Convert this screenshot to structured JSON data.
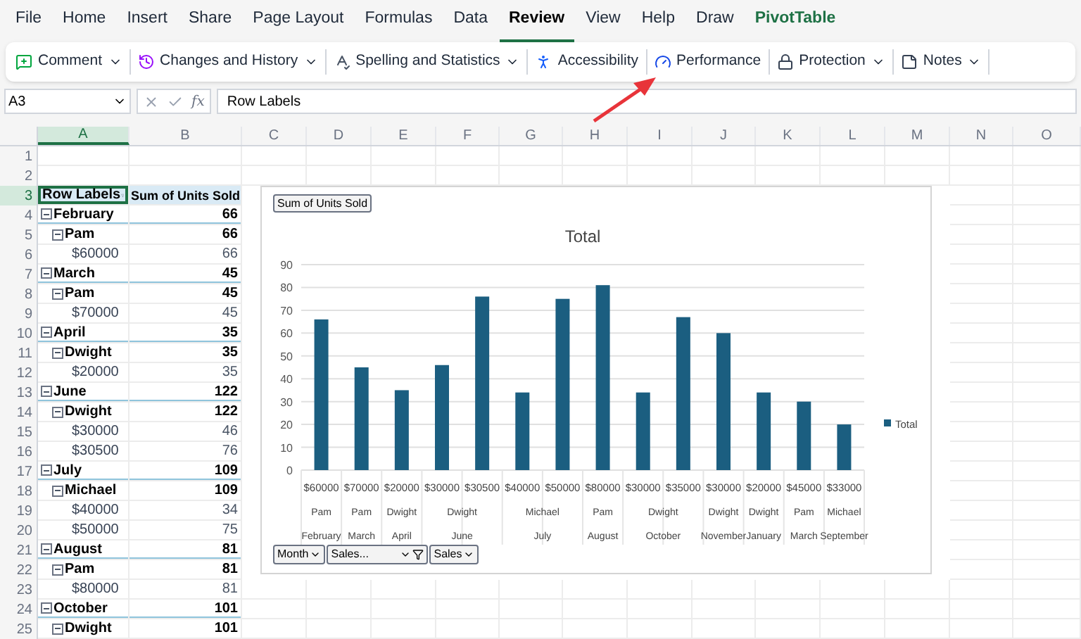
{
  "menu_tabs": [
    {
      "label": "File",
      "selected": false,
      "kind": "normal"
    },
    {
      "label": "Home",
      "selected": false,
      "kind": "normal"
    },
    {
      "label": "Insert",
      "selected": false,
      "kind": "normal"
    },
    {
      "label": "Share",
      "selected": false,
      "kind": "normal"
    },
    {
      "label": "Page Layout",
      "selected": false,
      "kind": "normal"
    },
    {
      "label": "Formulas",
      "selected": false,
      "kind": "normal"
    },
    {
      "label": "Data",
      "selected": false,
      "kind": "normal"
    },
    {
      "label": "Review",
      "selected": true,
      "kind": "normal"
    },
    {
      "label": "View",
      "selected": false,
      "kind": "normal"
    },
    {
      "label": "Help",
      "selected": false,
      "kind": "normal"
    },
    {
      "label": "Draw",
      "selected": false,
      "kind": "normal"
    },
    {
      "label": "PivotTable",
      "selected": false,
      "kind": "contextual"
    }
  ],
  "ribbon": [
    {
      "label": "Comment",
      "dropdown": true
    },
    {
      "label": "Changes and History",
      "dropdown": true
    },
    {
      "label": "Spelling and Statistics",
      "dropdown": true
    },
    {
      "label": "Accessibility",
      "dropdown": false
    },
    {
      "label": "Performance",
      "dropdown": false
    },
    {
      "label": "Protection",
      "dropdown": true
    },
    {
      "label": "Notes",
      "dropdown": true
    }
  ],
  "formula_bar": {
    "name_box": "A3",
    "fx": "fx",
    "value": "Row Labels"
  },
  "columns": [
    {
      "label": "A",
      "selected": true
    },
    {
      "label": "B",
      "selected": false
    },
    {
      "label": "C",
      "selected": false
    },
    {
      "label": "D",
      "selected": false
    },
    {
      "label": "E",
      "selected": false
    },
    {
      "label": "F",
      "selected": false
    },
    {
      "label": "G",
      "selected": false
    },
    {
      "label": "H",
      "selected": false
    },
    {
      "label": "I",
      "selected": false
    },
    {
      "label": "J",
      "selected": false
    },
    {
      "label": "K",
      "selected": false
    },
    {
      "label": "L",
      "selected": false
    },
    {
      "label": "M",
      "selected": false
    },
    {
      "label": "N",
      "selected": false
    },
    {
      "label": "O",
      "selected": false
    }
  ],
  "rows": [
    {
      "label": "1",
      "selected": false
    },
    {
      "label": "2",
      "selected": false
    },
    {
      "label": "3",
      "selected": true
    },
    {
      "label": "4",
      "selected": false
    },
    {
      "label": "5",
      "selected": false
    },
    {
      "label": "6",
      "selected": false
    },
    {
      "label": "7",
      "selected": false
    },
    {
      "label": "8",
      "selected": false
    },
    {
      "label": "9",
      "selected": false
    },
    {
      "label": "10",
      "selected": false
    },
    {
      "label": "11",
      "selected": false
    },
    {
      "label": "12",
      "selected": false
    },
    {
      "label": "13",
      "selected": false
    },
    {
      "label": "14",
      "selected": false
    },
    {
      "label": "15",
      "selected": false
    },
    {
      "label": "16",
      "selected": false
    },
    {
      "label": "17",
      "selected": false
    },
    {
      "label": "18",
      "selected": false
    },
    {
      "label": "19",
      "selected": false
    },
    {
      "label": "20",
      "selected": false
    },
    {
      "label": "21",
      "selected": false
    },
    {
      "label": "22",
      "selected": false
    },
    {
      "label": "23",
      "selected": false
    },
    {
      "label": "24",
      "selected": false
    },
    {
      "label": "25",
      "selected": false
    }
  ],
  "pivot": {
    "header": {
      "row_labels": "Row Labels",
      "values": "Sum of Units Sold"
    },
    "items": [
      {
        "kind": "group",
        "label": "February",
        "value": "66",
        "expanded": true,
        "children": [
          {
            "kind": "group",
            "label": "Pam",
            "value": "66",
            "expanded": true,
            "children": [
              {
                "kind": "leaf",
                "label": "$60000",
                "value": "66"
              }
            ]
          }
        ]
      },
      {
        "kind": "group",
        "label": "March",
        "value": "45",
        "expanded": true,
        "children": [
          {
            "kind": "group",
            "label": "Pam",
            "value": "45",
            "expanded": true,
            "children": [
              {
                "kind": "leaf",
                "label": "$70000",
                "value": "45"
              }
            ]
          }
        ]
      },
      {
        "kind": "group",
        "label": "April",
        "value": "35",
        "expanded": true,
        "children": [
          {
            "kind": "group",
            "label": "Dwight",
            "value": "35",
            "expanded": true,
            "children": [
              {
                "kind": "leaf",
                "label": "$20000",
                "value": "35"
              }
            ]
          }
        ]
      },
      {
        "kind": "group",
        "label": "June",
        "value": "122",
        "expanded": true,
        "children": [
          {
            "kind": "group",
            "label": "Dwight",
            "value": "122",
            "expanded": true,
            "children": [
              {
                "kind": "leaf",
                "label": "$30000",
                "value": "46"
              },
              {
                "kind": "leaf",
                "label": "$30500",
                "value": "76"
              }
            ]
          }
        ]
      },
      {
        "kind": "group",
        "label": "July",
        "value": "109",
        "expanded": true,
        "children": [
          {
            "kind": "group",
            "label": "Michael",
            "value": "109",
            "expanded": true,
            "children": [
              {
                "kind": "leaf",
                "label": "$40000",
                "value": "34"
              },
              {
                "kind": "leaf",
                "label": "$50000",
                "value": "75"
              }
            ]
          }
        ]
      },
      {
        "kind": "group",
        "label": "August",
        "value": "81",
        "expanded": true,
        "children": [
          {
            "kind": "group",
            "label": "Pam",
            "value": "81",
            "expanded": true,
            "children": [
              {
                "kind": "leaf",
                "label": "$80000",
                "value": "81"
              }
            ]
          }
        ]
      },
      {
        "kind": "group",
        "label": "October",
        "value": "101",
        "expanded": true,
        "children": [
          {
            "kind": "group",
            "label": "Dwight",
            "value": "101",
            "expanded": true
          }
        ]
      }
    ]
  },
  "pivot_chart": {
    "value_button": "Sum of Units Sold",
    "field_buttons": [
      {
        "label": "Month",
        "filtered": false
      },
      {
        "label": "Sales...",
        "filtered": true
      },
      {
        "label": "Sales",
        "filtered": false
      }
    ],
    "axis_groups": [
      [
        {
          "label": "Pam",
          "double": false
        },
        {
          "label": "Pam",
          "double": false
        },
        {
          "label": "Dwight",
          "double": false
        },
        {
          "label": "Dwight",
          "double": true
        },
        {
          "label": "Michael",
          "double": true
        },
        {
          "label": "Pam",
          "double": false
        },
        {
          "label": "Dwight",
          "double": true
        },
        {
          "label": "Dwight",
          "double": false
        },
        {
          "label": "Dwight",
          "double": false
        },
        {
          "label": "Pam",
          "double": false
        },
        {
          "label": "Michael",
          "double": false
        }
      ],
      [
        {
          "label": "February",
          "double": false
        },
        {
          "label": "March",
          "double": false
        },
        {
          "label": "April",
          "double": false
        },
        {
          "label": "June",
          "double": true
        },
        {
          "label": "July",
          "double": true
        },
        {
          "label": "August",
          "double": false
        },
        {
          "label": "October",
          "double": true
        },
        {
          "label": "November",
          "double": false
        },
        {
          "label": "January",
          "double": false
        },
        {
          "label": "March",
          "double": false
        },
        {
          "label": "September",
          "double": false
        }
      ]
    ],
    "chart_data": {
      "type": "bar",
      "title": "Total",
      "grid": true,
      "categories": [
        "$60000",
        "$70000",
        "$20000",
        "$30000",
        "$30500",
        "$40000",
        "$50000",
        "$80000",
        "$30000",
        "$35000",
        "$30000",
        "$20000",
        "$45000",
        "$33000"
      ],
      "series": [
        {
          "name": "Total",
          "color": "#1b5e80",
          "values": [
            66,
            45,
            35,
            46,
            76,
            34,
            75,
            81,
            34,
            67,
            60,
            34,
            30,
            20
          ]
        }
      ],
      "ylim": [
        0,
        90
      ],
      "yticks": [
        0,
        10,
        20,
        30,
        40,
        50,
        60,
        70,
        80,
        90
      ]
    }
  }
}
